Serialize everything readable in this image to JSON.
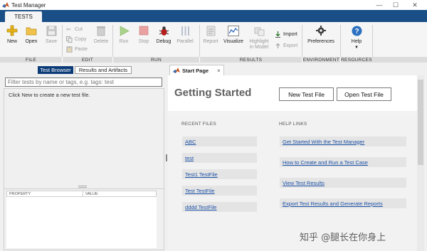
{
  "window": {
    "title": "Test Manager"
  },
  "window_controls": {
    "minimize": "—",
    "maximize": "☐",
    "close": "✕"
  },
  "ribbon": {
    "tab": "TESTS",
    "file": {
      "new": "New",
      "open": "Open",
      "save": "Save"
    },
    "edit": {
      "cut": "Cut",
      "copy": "Copy",
      "paste": "Paste",
      "delete": "Delete"
    },
    "run": {
      "run": "Run",
      "stop": "Stop",
      "debug": "Debug",
      "parallel": "Parallel"
    },
    "results": {
      "report": "Report",
      "visualize": "Visualize",
      "highlight": "Highlight in Model",
      "import": "Import",
      "export": "Export"
    },
    "environment": {
      "preferences": "Preferences"
    },
    "resources": {
      "help": "Help"
    },
    "groups": [
      "FILE",
      "EDIT",
      "RUN",
      "RESULTS",
      "ENVIRONMENT",
      "RESOURCES"
    ]
  },
  "left_panel": {
    "tabs": [
      "Test Browser",
      "Results and Artifacts"
    ],
    "filter_placeholder": "Filter tests by name or tags, e.g. tags: test",
    "hint": "Click New to create a new test file.",
    "property_columns": [
      "PROPERTY",
      "VALUE"
    ]
  },
  "document": {
    "tab_label": "Start Page",
    "tab_close": "×",
    "title": "Getting Started",
    "new_test_file": "New Test File",
    "open_test_file": "Open Test File",
    "recent_files_heading": "RECENT FILES",
    "recent_files": [
      "ABC",
      "test",
      "Test1 TestFile",
      "Test TestFile",
      "dddd TestFile"
    ],
    "help_links_heading": "HELP LINKS",
    "help_links": [
      "Get Started With the Test Manager",
      "How to Create and Run a Test Case",
      "View Test Results",
      "Export Test Results and Generate Reports"
    ]
  },
  "watermark": "知乎 @腿长在你身上",
  "colors": {
    "ribbon_blue": "#1a4e86",
    "active_tab": "#0c3c78",
    "link": "#1d52a8"
  }
}
